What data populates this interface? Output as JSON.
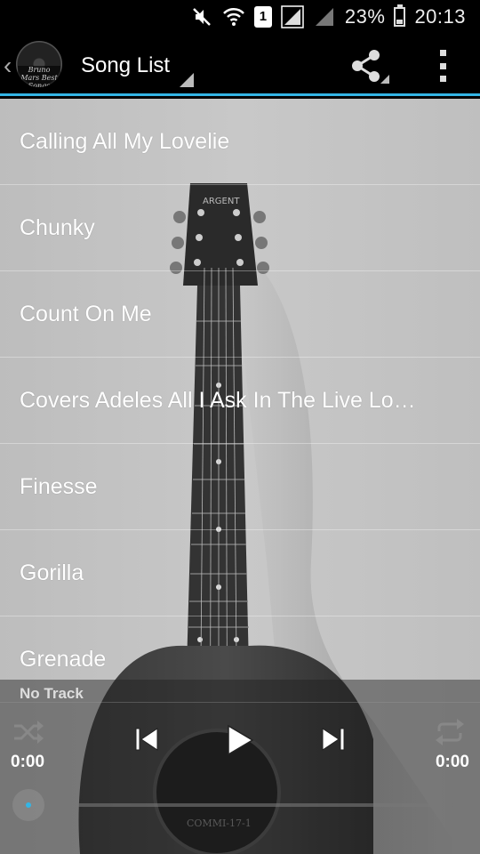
{
  "status_bar": {
    "battery": "23%",
    "clock": "20:13",
    "sim_slot": "1",
    "icons": [
      "mute-icon",
      "wifi-icon",
      "sim-icon",
      "signal-icon",
      "signal-icon-2",
      "battery-icon"
    ]
  },
  "action_bar": {
    "title": "Song List",
    "logo_text": "Bruno Mars Best Songs",
    "icons": [
      "back-chevron-icon",
      "share-icon",
      "overflow-menu-icon"
    ],
    "accent_color": "#33b5e5"
  },
  "songs": [
    "Calling All My Lovelie",
    "Chunky",
    "Count On Me",
    "Covers Adeles All I Ask In The Live Lo…",
    "Finesse",
    "Gorilla",
    "Grenade"
  ],
  "player": {
    "now_playing": "No Track",
    "elapsed": "0:00",
    "duration": "0:00",
    "progress": 0,
    "icons": [
      "shuffle-icon",
      "previous-icon",
      "play-icon",
      "next-icon",
      "repeat-icon"
    ]
  }
}
